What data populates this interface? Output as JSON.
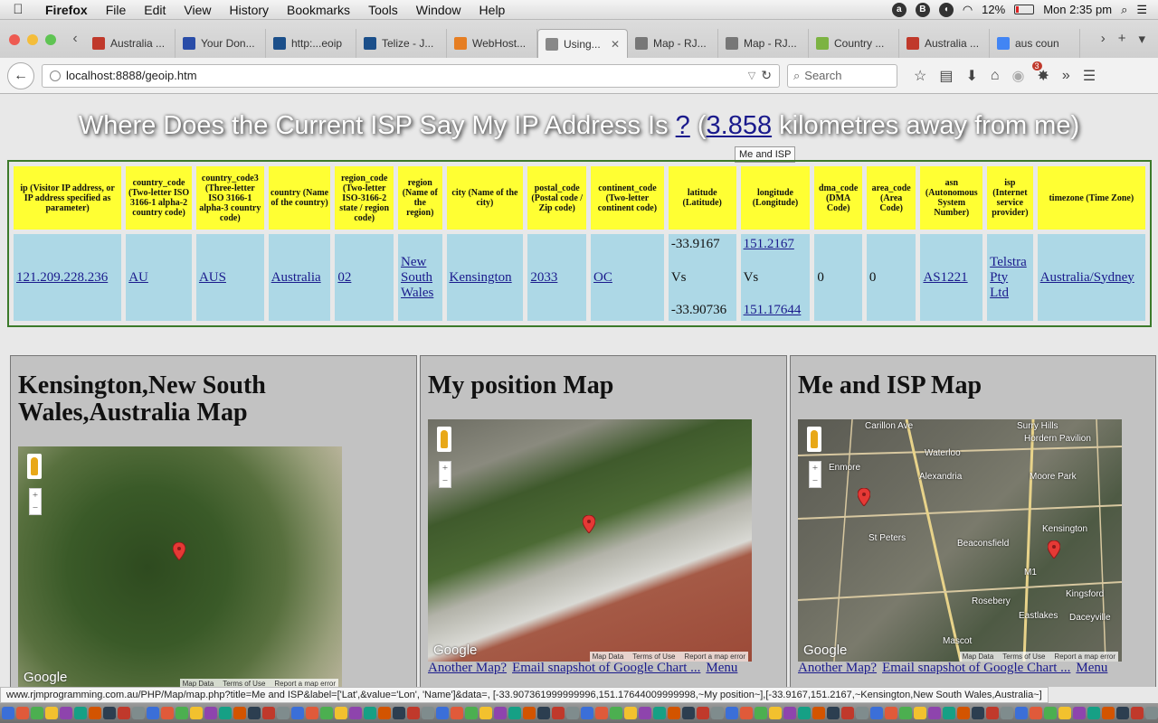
{
  "menubar": {
    "app_name": "Firefox",
    "items": [
      "File",
      "Edit",
      "View",
      "History",
      "Bookmarks",
      "Tools",
      "Window",
      "Help"
    ],
    "battery": "12%",
    "clock": "Mon 2:35 pm"
  },
  "tabs": [
    {
      "label": "Australia ...",
      "color": "#c0392b"
    },
    {
      "label": "Your Don...",
      "color": "#2a4da8"
    },
    {
      "label": "http:...eoip",
      "color": "#1b4f8a"
    },
    {
      "label": "Telize - J...",
      "color": "#1b4f8a"
    },
    {
      "label": "WebHost...",
      "color": "#e67e22"
    },
    {
      "label": "Using...",
      "color": "#888888",
      "active": true
    },
    {
      "label": "Map - RJ...",
      "color": "#777777"
    },
    {
      "label": "Map - RJ...",
      "color": "#777777"
    },
    {
      "label": "Country ...",
      "color": "#7cb342"
    },
    {
      "label": "Australia ...",
      "color": "#c0392b"
    },
    {
      "label": "aus coun",
      "color": "#4285f4"
    }
  ],
  "tab_close_glyph": "✕",
  "navbar": {
    "url": "localhost:8888/geoip.htm",
    "search_placeholder": "Search",
    "badge_count": "3"
  },
  "headline": {
    "prefix": "Where Does the Current ISP Say My IP Address Is ",
    "question_link": "?",
    "open_paren": " (",
    "distance_link": "3.858",
    "suffix": " kilometres away from me)",
    "tooltip": "Me and ISP"
  },
  "table": {
    "headers": [
      "ip (Visitor IP address, or IP address specified as parameter)",
      "country_code (Two-letter ISO 3166-1 alpha-2 country code)",
      "country_code3 (Three-letter ISO 3166-1 alpha-3 country code)",
      "country (Name of the country)",
      "region_code (Two-letter ISO-3166-2 state / region code)",
      "region (Name of the region)",
      "city (Name of the city)",
      "postal_code (Postal code / Zip code)",
      "continent_code (Two-letter continent code)",
      "latitude (Latitude)",
      "longitude (Longitude)",
      "dma_code (DMA Code)",
      "area_code (Area Code)",
      "asn (Autonomous System Number)",
      "isp (Internet service provider)",
      "timezone (Time Zone)"
    ],
    "row": {
      "ip": "121.209.228.236",
      "country_code": "AU",
      "country_code3": "AUS",
      "country": "Australia",
      "region_code": "02",
      "region": "New South Wales",
      "city": "Kensington",
      "postal_code": "2033",
      "continent_code": "OC",
      "latitude_isp": "-33.9167",
      "vs": "Vs",
      "latitude_me": "-33.90736",
      "longitude_isp": "151.2167",
      "longitude_me": "151.17644",
      "dma_code": "0",
      "area_code": "0",
      "asn": "AS1221",
      "isp": "Telstra Pty Ltd",
      "timezone": "Australia/Sydney"
    }
  },
  "panels": {
    "city_map_title": "Kensington,New South Wales,Australia Map",
    "position_map_title": "My position Map",
    "me_isp_map_title": "Me and ISP Map",
    "another_map": "Another Map?",
    "email_snapshot": "Email snapshot of Google Chart ...",
    "menu": "Menu",
    "google": "Google",
    "map_data": "Map Data",
    "terms": "Terms of Use",
    "report": "Report a map error",
    "zoom_in": "+",
    "zoom_out": "−"
  },
  "map_places": [
    "Carillon Ave",
    "Surry Hills",
    "Hordern Pavilion",
    "Waterloo",
    "Enmore",
    "Alexandria",
    "Moore Park",
    "St Peters",
    "Kensington",
    "Beaconsfield",
    "M1",
    "Kingsford",
    "Rosebery",
    "Eastlakes",
    "Daceyville",
    "Mascot"
  ],
  "statusbar": "www.rjmprogramming.com.au/PHP/Map/map.php?title=Me and ISP&label=['Lat',&value='Lon', 'Name']&data=, [-33.907361999999996,151.17644009999998,~My position~],[-33.9167,151.2167,~Kensington,New South Wales,Australia~]",
  "colors": {
    "header_yellow": "#ffff33",
    "cell_blue": "#add8e6",
    "link": "#1a1a8c",
    "table_border": "#3c7a2a"
  }
}
